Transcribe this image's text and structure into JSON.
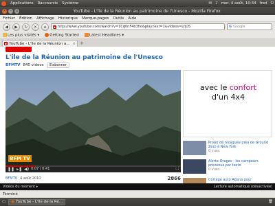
{
  "panel": {
    "menus": [
      "Applications",
      "Raccourcis",
      "Système"
    ],
    "clock": "mer. 4 août, 10:34",
    "user": "fred"
  },
  "window": {
    "title": "YouTube - L'île de la Réunion au patrimoine de l'Unesco - Mozilla Firefox"
  },
  "menubar": [
    "Fichier",
    "Édition",
    "Affichage",
    "Historique",
    "Marque-pages",
    "Outils",
    "Aide"
  ],
  "navbar": {
    "url": "http://www.youtube.com/watch?v=1Cq0nF4b3ho&playnext=1&videos=LfjUS",
    "search_placeholder": "Google"
  },
  "bookmarks": [
    "Les plus visités ▾",
    "Getting Started",
    "Latest Headlines ▾"
  ],
  "tab": {
    "label": "YouTube - L'île de la Réunion a..."
  },
  "page": {
    "title": "L'île de la Réunion au patrimoine de l'Unesco",
    "channel": "BFMTV",
    "video_count": "840 vidéos",
    "subscribe_label": "S'abonner",
    "video_logo": "BFM TV",
    "time": "0:07 / 0:41",
    "date": "4 août 2010",
    "views": "2866",
    "progress_fraction": 0.17
  },
  "ad": {
    "prefix": "avec le ",
    "highlight": "confort",
    "line2": "d'un 4x4"
  },
  "related": [
    {
      "title": "Projet de mosquée près de Ground Zero à New York",
      "meta": "0 vues"
    },
    {
      "title": "Alerte Orages : les campeurs prévenus par texto",
      "meta": "0 vues"
    },
    {
      "title": "Cortège auto Adana pour",
      "meta": ""
    }
  ],
  "yt_bottom": {
    "left": "Vidéos du moment ▸",
    "right": "Lecture automatique (désactivée)"
  },
  "status": "Terminé",
  "taskbar": {
    "window_label": "YouTube - L'île de la Ré..."
  }
}
